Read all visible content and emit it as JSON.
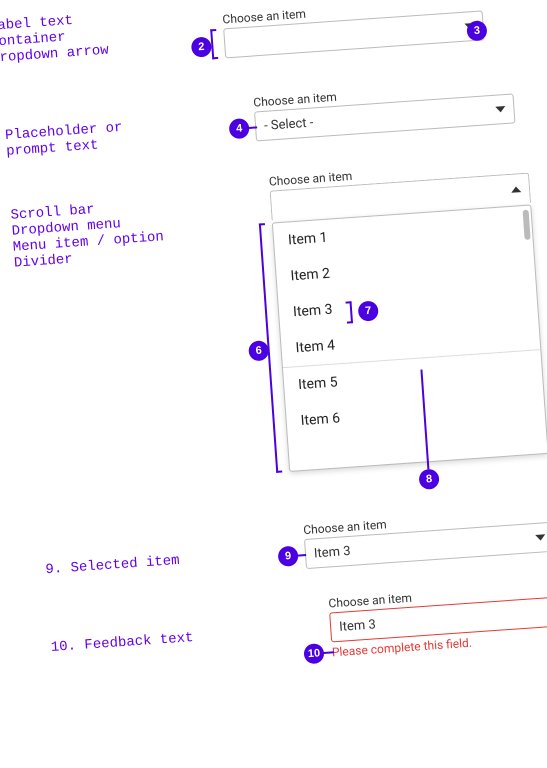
{
  "legend": {
    "block1": [
      "abel text",
      "ontainer",
      "ropdown arrow"
    ],
    "block2": [
      "Placeholder or",
      "prompt text"
    ],
    "block3": [
      "Scroll bar",
      "Dropdown menu",
      "Menu item / option",
      "Divider"
    ],
    "item9": "9. Selected item",
    "item10": "10. Feedback text"
  },
  "badges": {
    "b2": "2",
    "b3": "3",
    "b4": "4",
    "b6": "6",
    "b7": "7",
    "b8": "8",
    "b9": "9",
    "b10": "10"
  },
  "selects": {
    "s1": {
      "label": "Choose an item",
      "value": ""
    },
    "s2": {
      "label": "Choose an item",
      "value": "- Select -"
    },
    "s3": {
      "label": "Choose an item",
      "items": [
        "Item 1",
        "Item 2",
        "Item 3",
        "Item 4",
        "Item 5",
        "Item 6"
      ]
    },
    "s4": {
      "label": "Choose an item",
      "value": "Item 3"
    },
    "s5": {
      "label": "Choose an item",
      "value": "Item 3",
      "error": "Please complete this field."
    }
  }
}
